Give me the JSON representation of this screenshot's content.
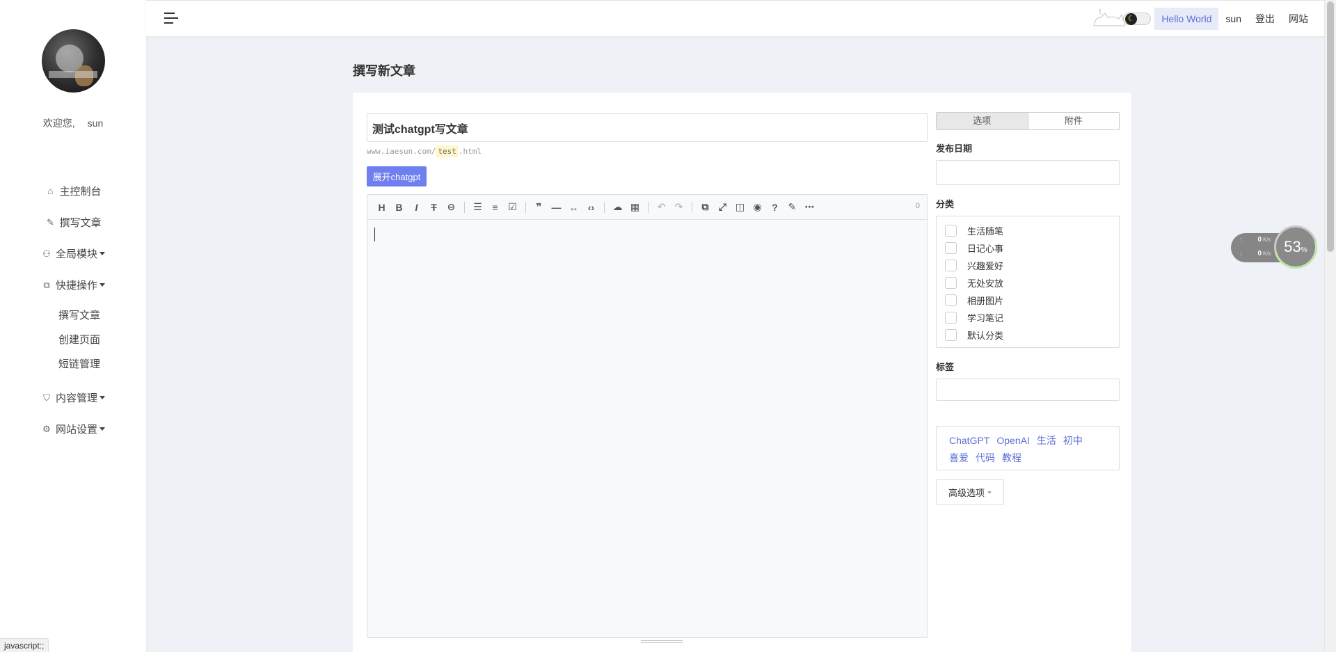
{
  "sidebar": {
    "welcome_text": "欢迎您,",
    "username": "sun",
    "nav": [
      {
        "label": "主控制台",
        "icon": "home-icon"
      },
      {
        "label": "撰写文章",
        "icon": "edit-icon"
      },
      {
        "label": "全局模块",
        "icon": "modules-icon"
      },
      {
        "label": "快捷操作",
        "icon": "external-edit-icon"
      },
      {
        "label": "内容管理",
        "icon": "shield-icon"
      },
      {
        "label": "网站设置",
        "icon": "gear-icon"
      }
    ],
    "quick_actions": [
      "撰写文章",
      "创建页面",
      "短链管理"
    ]
  },
  "topbar": {
    "links": [
      "Hello World",
      "sun",
      "登出",
      "网站"
    ]
  },
  "page_title": "撰写新文章",
  "editor": {
    "title_value": "测试chatgpt写文章",
    "slug_prefix": "www.iaesun.com/",
    "slug_value": "test",
    "slug_suffix": ".html",
    "chatgpt_button": "展开chatgpt",
    "word_count": "0"
  },
  "sidepanel": {
    "tabs": [
      "选项",
      "附件"
    ],
    "date_label": "发布日期",
    "category_label": "分类",
    "categories": [
      "生活随笔",
      "日记心事",
      "兴趣爱好",
      "无处安放",
      "相册图片",
      "学习笔记",
      "默认分类"
    ],
    "tag_label": "标签",
    "tag_suggestions": [
      "ChatGPT",
      "OpenAI",
      "生活",
      "初中",
      "喜爱",
      "代码",
      "教程"
    ],
    "advanced_button": "高级选项"
  },
  "netspeed": {
    "up": "0",
    "down": "0",
    "unit": "K/s",
    "percent": "53",
    "percent_sign": "%"
  },
  "statusbar": "javascript:;"
}
